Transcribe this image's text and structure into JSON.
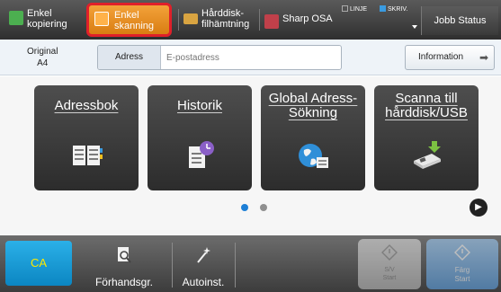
{
  "topbar": {
    "tabs": [
      {
        "label_line1": "Enkel",
        "label_line2": "kopiering"
      },
      {
        "label_line1": "Enkel",
        "label_line2": "skanning"
      },
      {
        "label_line1": "Hårddisk-",
        "label_line2": "filhämtning"
      },
      {
        "label_line1": "Sharp OSA",
        "label_line2": ""
      }
    ],
    "status": {
      "line": "LINJE",
      "write": "SKRIV."
    },
    "job_status": "Jobb Status"
  },
  "original": {
    "label": "Original",
    "size": "A4"
  },
  "address": {
    "label": "Adress",
    "placeholder": "E-postadress"
  },
  "information_button": "Information",
  "tiles": [
    {
      "label_line1": "Adressbok",
      "label_line2": "",
      "icon": "address-book-icon"
    },
    {
      "label_line1": "Historik",
      "label_line2": "",
      "icon": "history-icon"
    },
    {
      "label_line1": "Global Adress-",
      "label_line2": "Sökning",
      "icon": "globe-icon"
    },
    {
      "label_line1": "Scanna till",
      "label_line2": "hårddisk/USB",
      "icon": "hdd-usb-icon"
    }
  ],
  "pager": {
    "pages": 2,
    "current": 1
  },
  "bottom": {
    "ca": "CA",
    "preview": "Förhandsgr.",
    "auto": "Autoinst.",
    "start_bw_line1": "S/V",
    "start_bw_line2": "Start",
    "start_color_line1": "Färg",
    "start_color_line2": "Start"
  },
  "colors": {
    "active_tab": "#e0202a",
    "ca_button": "#0b86c2",
    "ca_text": "#ffe800",
    "pager_active": "#1d7fd6"
  }
}
